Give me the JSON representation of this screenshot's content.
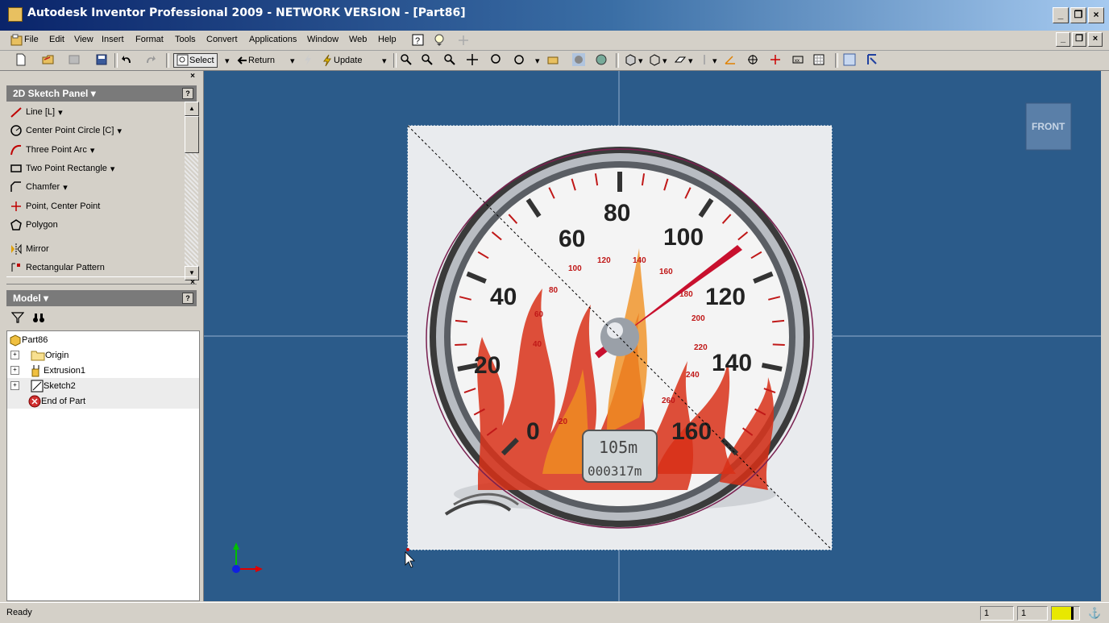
{
  "window": {
    "title": "Autodesk Inventor Professional 2009 - NETWORK VERSION - [Part86]"
  },
  "menu": [
    "File",
    "Edit",
    "View",
    "Insert",
    "Format",
    "Tools",
    "Convert",
    "Applications",
    "Window",
    "Web",
    "Help"
  ],
  "toolbar": {
    "select_label": "Select",
    "return_label": "Return",
    "update_label": "Update"
  },
  "sketch_panel": {
    "title": "2D Sketch Panel",
    "tools": [
      {
        "label": "Line   [L]",
        "dropdown": true,
        "icon": "line-icon"
      },
      {
        "label": "Center Point Circle   [C]",
        "dropdown": true,
        "icon": "circle-icon"
      },
      {
        "label": "Three Point Arc",
        "dropdown": true,
        "icon": "arc-icon"
      },
      {
        "label": "Two Point Rectangle",
        "dropdown": true,
        "icon": "rectangle-icon"
      },
      {
        "label": "Chamfer",
        "dropdown": true,
        "icon": "chamfer-icon"
      },
      {
        "label": "Point, Center Point",
        "dropdown": false,
        "icon": "point-icon"
      },
      {
        "label": "Polygon",
        "dropdown": false,
        "icon": "polygon-icon"
      },
      {
        "label": "Mirror",
        "dropdown": false,
        "icon": "mirror-icon"
      },
      {
        "label": "Rectangular Pattern",
        "dropdown": false,
        "icon": "rectangular-pattern-icon"
      }
    ]
  },
  "model_panel": {
    "title": "Model",
    "tree": [
      {
        "label": "Part86",
        "icon": "part-icon",
        "level": 0
      },
      {
        "label": "Origin",
        "icon": "folder-icon",
        "level": 1
      },
      {
        "label": "Extrusion1",
        "icon": "extrusion-icon",
        "level": 1
      },
      {
        "label": "Sketch2",
        "icon": "sketch-icon",
        "level": 1
      },
      {
        "label": "End of Part",
        "icon": "end-of-part-icon",
        "level": 1
      }
    ]
  },
  "viewport": {
    "viewcube_label": "FRONT",
    "gauge": {
      "major_labels": [
        "0",
        "20",
        "40",
        "60",
        "80",
        "100",
        "120",
        "140",
        "160"
      ],
      "minor_labels": [
        "20",
        "40",
        "60",
        "80",
        "100",
        "120",
        "140",
        "160",
        "180",
        "200",
        "220",
        "240",
        "260"
      ],
      "odometer_top": "105m",
      "odometer_bottom": "000317m"
    }
  },
  "status": {
    "text": "Ready",
    "field1": "1",
    "field2": "1"
  },
  "colors": {
    "viewport_bg": "#2b5b8a",
    "title_gradient_start": "#0a246a",
    "title_gradient_end": "#a6caf0",
    "needle": "#c8102e"
  }
}
